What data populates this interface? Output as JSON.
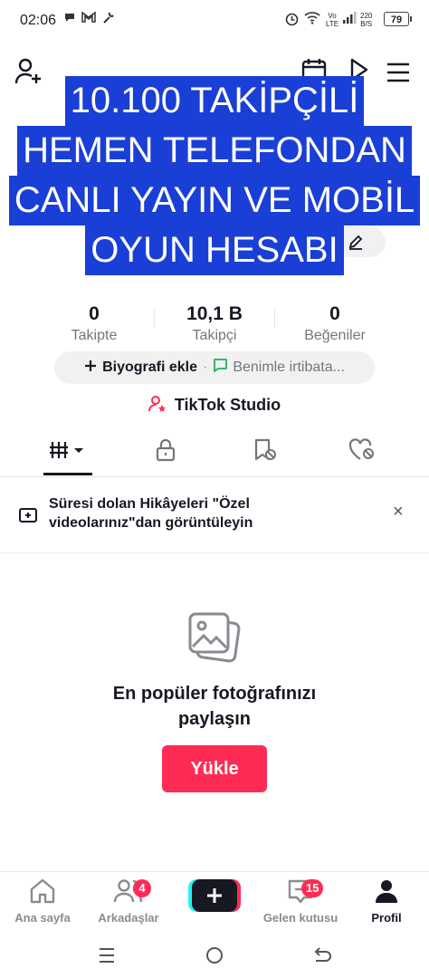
{
  "status_bar": {
    "time": "02:06",
    "net_top": "Vo",
    "net_bottom": "LTE",
    "speed_top": "220",
    "speed_bottom": "B/S",
    "battery": "79"
  },
  "header": {
    "banner_lines": [
      "10.100 TAKİPÇİLİ",
      "HEMEN TELEFONDAN",
      "CANLI YAYIN VE MOBİL",
      "OYUN HESABI"
    ]
  },
  "stats": [
    {
      "value": "0",
      "label": "Takipte"
    },
    {
      "value": "10,1 B",
      "label": "Takipçi"
    },
    {
      "value": "0",
      "label": "Beğeniler"
    }
  ],
  "bio": {
    "add_label": "Biyografi ekle",
    "separator": "·",
    "contact_label": "Benimle irtibata..."
  },
  "studio_label": "TikTok Studio",
  "notice": {
    "line1": "Süresi dolan Hikâyeleri \"Özel",
    "line2": "videolarınız\"dan görüntüleyin",
    "close": "×"
  },
  "empty_state": {
    "line1": "En popüler fotoğrafınızı",
    "line2": "paylaşın",
    "button": "Yükle"
  },
  "bottom_nav": [
    {
      "label": "Ana sayfa",
      "icon": "home-icon"
    },
    {
      "label": "Arkadaşlar",
      "icon": "friends-icon",
      "badge": "4"
    },
    {
      "label": "",
      "icon": "create-icon"
    },
    {
      "label": "Gelen kutusu",
      "icon": "inbox-icon",
      "badge": "15"
    },
    {
      "label": "Profil",
      "icon": "profile-icon"
    }
  ],
  "colors": {
    "accent": "#fe2c55",
    "banner_bg": "#1a3fd6",
    "text": "#161823",
    "muted": "#75767c"
  }
}
